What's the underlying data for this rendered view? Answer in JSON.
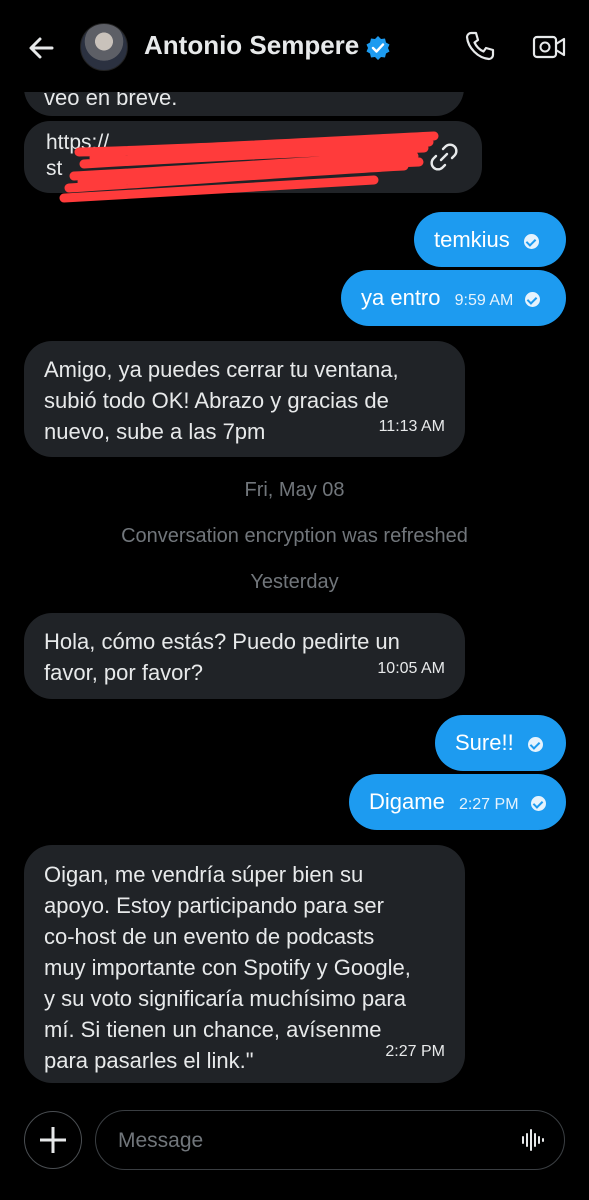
{
  "header": {
    "contact_name": "Antonio Sempere",
    "back_icon": "arrow-left-icon",
    "verified_icon": "verified-badge-icon",
    "call_icon": "phone-icon",
    "video_icon": "video-camera-icon",
    "accent": "#1d9bf0"
  },
  "messages": [
    {
      "direction": "in",
      "text": "veo en breve.",
      "partial": true
    },
    {
      "direction": "in",
      "type": "link",
      "text_line1": "https://",
      "text_line2": "st",
      "redacted": true,
      "icon": "link-icon"
    },
    {
      "direction": "out",
      "text": "temkius",
      "time": "",
      "read": true
    },
    {
      "direction": "out",
      "text": "ya entro",
      "time": "9:59 AM",
      "read": true
    },
    {
      "direction": "in",
      "text": "Amigo, ya puedes cerrar tu ventana, subió todo OK! Abrazo y gracias de nuevo, sube a las 7pm",
      "time": "11:13 AM"
    },
    {
      "direction": "out",
      "text": "Sure!!",
      "time": "",
      "read": true
    },
    {
      "direction": "out",
      "text": "Digame",
      "time": "2:27 PM",
      "read": true
    }
  ],
  "msg5": {
    "line1": "Amigo, ya puedes cerrar tu ventana,",
    "line2": "subió todo OK! Abrazo y gracias de",
    "line3": "nuevo, sube a las 7pm",
    "time": "11:13 AM"
  },
  "separators": {
    "date1": "Fri, May 08",
    "system": "Conversation encryption was refreshed",
    "date2": "Yesterday"
  },
  "msg_hola": {
    "line1": "Hola, cómo estás? Puedo pedirte un",
    "line2": "favor, por favor?",
    "time": "10:05 AM"
  },
  "msg_oigan": {
    "lines": [
      "Oigan, me vendría súper bien su",
      "apoyo. Estoy participando para ser",
      "co-host de un evento de podcasts",
      "muy importante con Spotify y Google,",
      "y su voto significaría muchísimo para",
      "mí. Si tienen un chance, avísenme",
      "para pasarles el link.\""
    ],
    "time": "2:27 PM"
  },
  "out": {
    "temkius": "temkius",
    "ya_entro": "ya entro",
    "ya_entro_time": "9:59 AM",
    "sure": "Sure!!",
    "digame": "Digame",
    "digame_time": "2:27 PM"
  },
  "top": {
    "partial_text": "veo en breve.",
    "link_line1": "https://",
    "link_line2": "st"
  },
  "composer": {
    "placeholder": "Message",
    "add_icon": "plus-icon",
    "voice_icon": "voice-waveform-icon"
  }
}
